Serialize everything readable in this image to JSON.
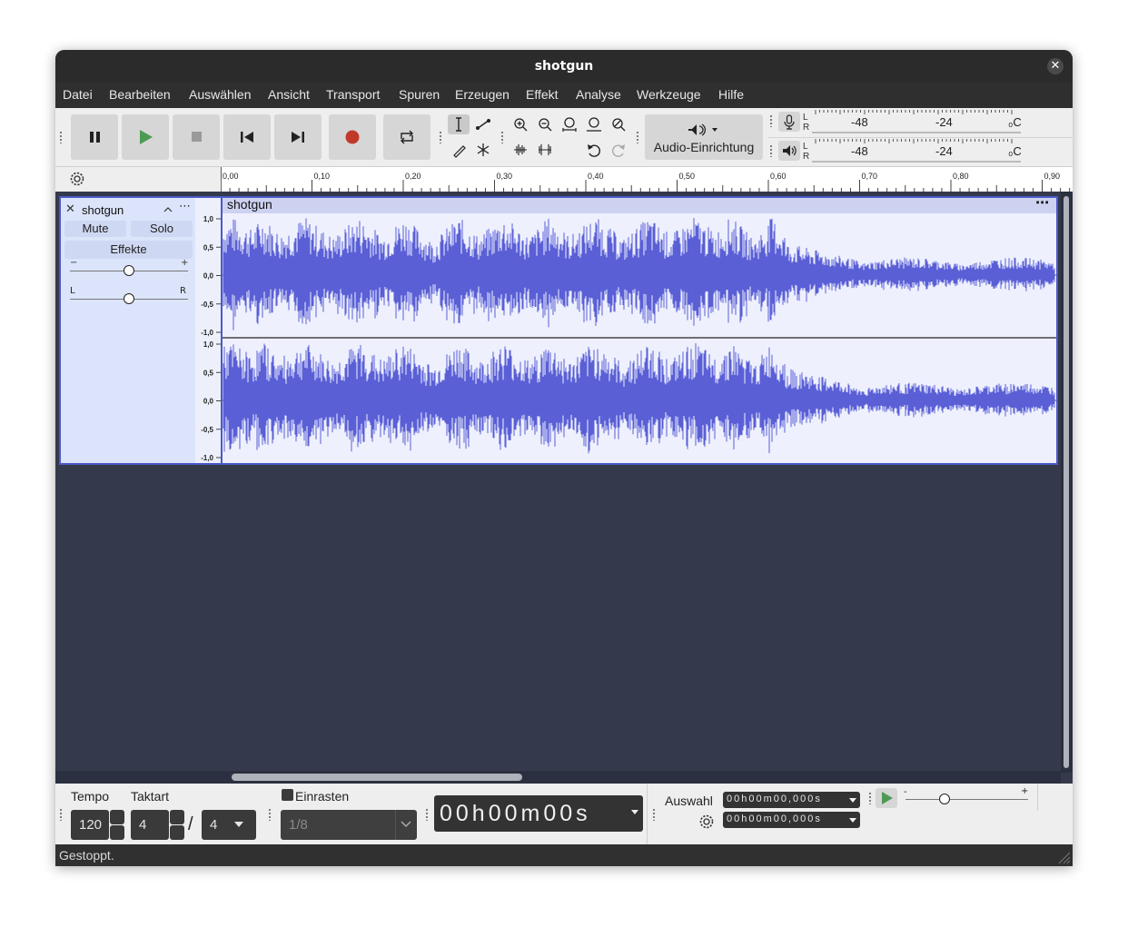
{
  "window": {
    "title": "shotgun"
  },
  "menu": [
    "Datei",
    "Bearbeiten",
    "Auswählen",
    "Ansicht",
    "Transport",
    "Spuren",
    "Erzeugen",
    "Effekt",
    "Analyse",
    "Werkzeuge",
    "Hilfe"
  ],
  "toolbar": {
    "transport_icons": [
      "pause-icon",
      "play-icon",
      "stop-icon",
      "skip-to-start-icon",
      "skip-to-end-icon",
      "record-icon",
      "loop-icon"
    ],
    "tool_icons": [
      "selection-tool-icon",
      "envelope-tool-icon",
      "draw-tool-icon",
      "multi-tool-icon"
    ],
    "edit_icons": [
      "zoom-in-icon",
      "zoom-out-icon",
      "fit-selection-icon",
      "fit-project-icon",
      "zoom-toggle-icon",
      "trim-outside-icon",
      "silence-selection-icon",
      "undo-icon",
      "redo-icon"
    ],
    "audio_setup": {
      "label": "Audio-Einrichtung",
      "icon": "speaker-icon"
    },
    "meters": {
      "record": {
        "icon": "microphone-icon",
        "channels": [
          "L",
          "R"
        ],
        "ticks": [
          "-48",
          "-24"
        ]
      },
      "playback": {
        "icon": "speaker-icon",
        "channels": [
          "L",
          "R"
        ],
        "ticks": [
          "-48",
          "-24"
        ]
      }
    },
    "colors": {
      "play": "#4e9a55",
      "record": "#c0392b"
    }
  },
  "timeline": {
    "ticks": [
      "0,00",
      "0,10",
      "0,20",
      "0,30",
      "0,40",
      "0,50",
      "0,60",
      "0,70",
      "0,80",
      "0,90"
    ]
  },
  "track": {
    "name": "shotgun",
    "mute_label": "Mute",
    "solo_label": "Solo",
    "effects_label": "Effekte",
    "gain": {
      "minus": "−",
      "plus": "+",
      "value": 0.5
    },
    "pan": {
      "left": "L",
      "right": "R",
      "value": 0.5
    },
    "clip_title": "shotgun",
    "scale_labels": [
      "1,0",
      "0,5",
      "0,0",
      "-0,5",
      "-1,0"
    ],
    "waveform_color": "#5a5fd6"
  },
  "bottom": {
    "tempo_label": "Tempo",
    "tempo_value": "120",
    "meter_label": "Taktart",
    "beats": "4",
    "slash": "/",
    "beat_value": "4",
    "snap_label": "Einrasten",
    "snap_value": "1/8",
    "time_display": "00h00m00s",
    "selection_label": "Auswahl",
    "selection_start": "00h00m00,000s",
    "selection_end": "00h00m00,000s",
    "speed": {
      "minus": "-",
      "plus": "+",
      "value": 0.32
    }
  },
  "status": {
    "text": "Gestoppt."
  }
}
